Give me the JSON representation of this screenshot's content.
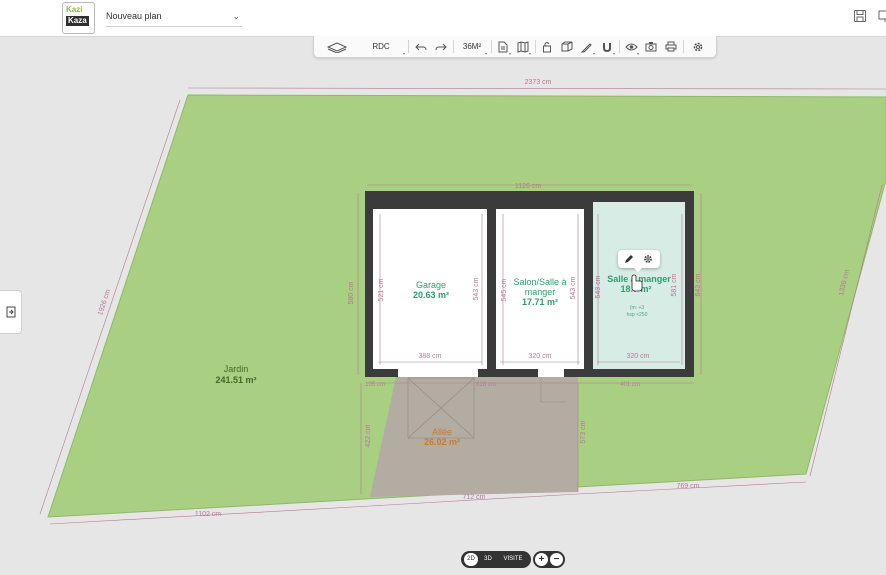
{
  "app": {
    "logo_line1": "Kazi",
    "logo_line2": "Kaza",
    "plan_name": "Nouveau plan"
  },
  "toolbar": {
    "level_label": "RDC",
    "surface_label": "36M²"
  },
  "plan": {
    "terrain_label": "Jardin",
    "terrain_area": "241.51 m²",
    "terrain_dim_top": "2373 cm",
    "terrain_dim_left": "1926 cm",
    "terrain_dim_right": "1339 cm",
    "terrain_dim_bottom_left": "1102 cm",
    "terrain_dim_bottom_mid": "712 cm",
    "terrain_dim_bottom_right": "769 cm",
    "house_dim_top": "1126 cm",
    "house_dim_left": "580 cm",
    "house_dim_right": "643 cm",
    "house_dim_bottom_left": "105 cm",
    "house_dim_bottom_mid": "618 cm",
    "house_dim_bottom_right": "401 cm",
    "allee_dim_left": "422 cm",
    "allee_dim_right": "573 cm",
    "allee": {
      "name": "Allée",
      "area": "26.02 m²"
    },
    "rooms": [
      {
        "name": "Garage",
        "area": "20.63 m²",
        "dim_width": "388 cm",
        "dim_h1": "521 cm",
        "dim_h2": "543 cm"
      },
      {
        "name_line1": "Salon/Salle à",
        "name_line2": "manger",
        "area": "17.71 m²",
        "dim_width": "320 cm",
        "dim_h1": "545 cm",
        "dim_h2": "543 cm"
      },
      {
        "name": "Salle à manger",
        "area": "18.7 m²",
        "dim_width": "320 cm",
        "dim_h1": "543 cm",
        "dim_h2": "581 cm",
        "extra1": "(m: +3",
        "extra2": "hsp <250"
      }
    ]
  },
  "bottom": {
    "view_2d": "2D",
    "view_3d": "3D",
    "view_visit": "VISITE",
    "zoom_in": "+",
    "zoom_out": "−"
  },
  "colors": {
    "garden": "#a9cf82",
    "garden_stroke": "#8fb865",
    "background": "#e6e6e6",
    "wall": "#3b3b3b",
    "room_label": "#2f9e6e",
    "selected_room": "#d7ece5",
    "allee": "#b2aca2",
    "allee_label": "#c97a2c",
    "dimension": "#b57994"
  }
}
